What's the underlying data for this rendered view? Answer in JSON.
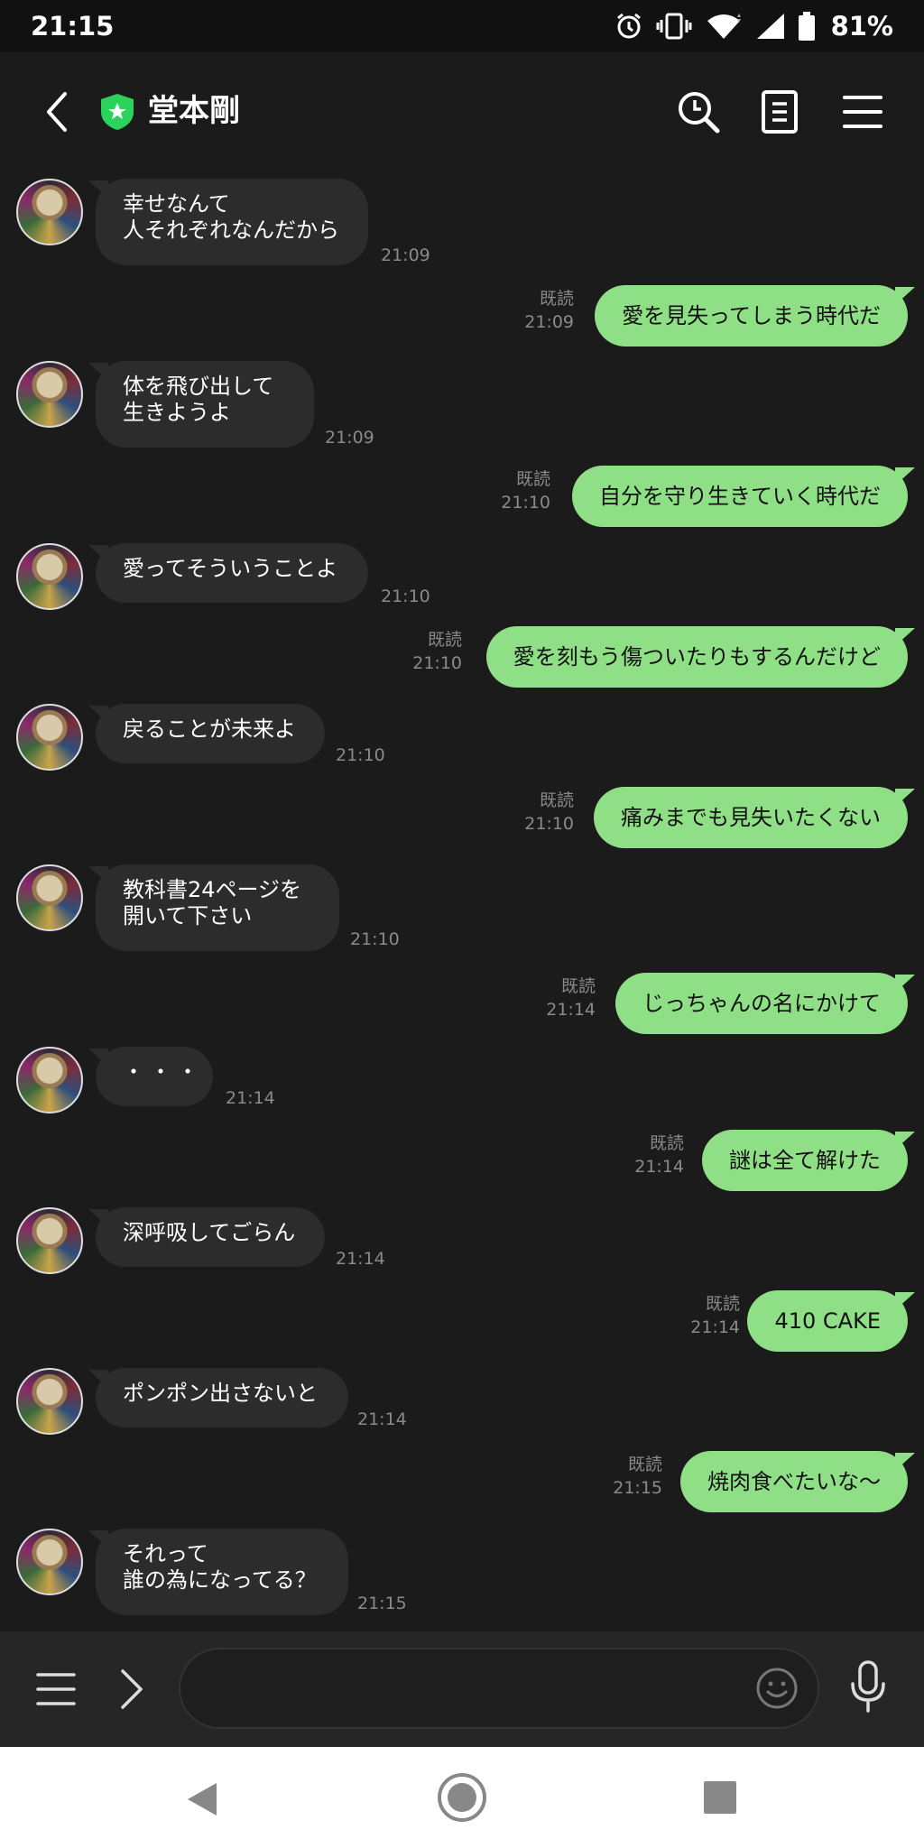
{
  "status": {
    "time": "21:15",
    "battery": "81%"
  },
  "header": {
    "title": "堂本剛",
    "icons": [
      "back-icon",
      "official-shield-icon",
      "search-icon",
      "notes-icon",
      "menu-icon"
    ]
  },
  "messages": [
    {
      "side": "in",
      "text": "幸せなんて\n人それぞれなんだから",
      "time": "21:09"
    },
    {
      "side": "out",
      "text": "愛を見失ってしまう時代だ",
      "read": "既読",
      "time": "21:09"
    },
    {
      "side": "in",
      "text": "体を飛び出して\n生きようよ",
      "time": "21:09"
    },
    {
      "side": "out",
      "text": "自分を守り生きていく時代だ",
      "read": "既読",
      "time": "21:10"
    },
    {
      "side": "in",
      "text": "愛ってそういうことよ",
      "time": "21:10"
    },
    {
      "side": "out",
      "text": "愛を刻もう傷ついたりもするんだけど",
      "read": "既読",
      "time": "21:10"
    },
    {
      "side": "in",
      "text": "戻ることが未来よ",
      "time": "21:10"
    },
    {
      "side": "out",
      "text": "痛みまでも見失いたくない",
      "read": "既読",
      "time": "21:10"
    },
    {
      "side": "in",
      "text": "教科書24ページを\n開いて下さい",
      "time": "21:10"
    },
    {
      "side": "out",
      "text": "じっちゃんの名にかけて",
      "read": "既読",
      "time": "21:14"
    },
    {
      "side": "in",
      "text": "・・・",
      "time": "21:14"
    },
    {
      "side": "out",
      "text": "謎は全て解けた",
      "read": "既読",
      "time": "21:14"
    },
    {
      "side": "in",
      "text": "深呼吸してごらん",
      "time": "21:14"
    },
    {
      "side": "out",
      "text": "410 CAKE",
      "read": "既読",
      "time": "21:14"
    },
    {
      "side": "in",
      "text": "ポンポン出さないと",
      "time": "21:14"
    },
    {
      "side": "out",
      "text": "焼肉食べたいな～",
      "read": "既読",
      "time": "21:15"
    },
    {
      "side": "in",
      "text": "それって\n誰の為になってる？",
      "time": "21:15"
    }
  ],
  "input": {
    "placeholder": ""
  },
  "colors": {
    "outgoing_bubble": "#8fdf86",
    "incoming_bubble": "#2c2c2c",
    "background": "#1b1b1b",
    "official_badge": "#2bd35a"
  }
}
